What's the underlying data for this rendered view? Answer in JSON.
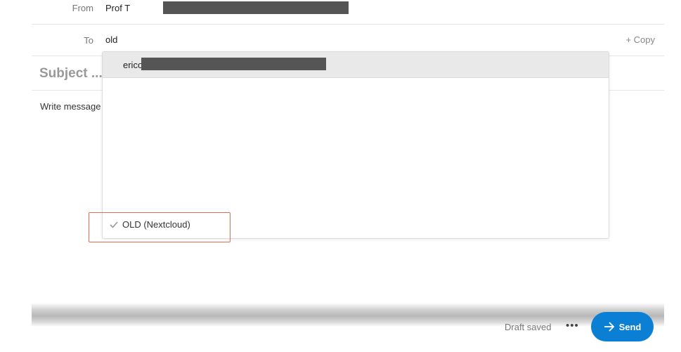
{
  "from": {
    "label": "From",
    "value": "Prof T"
  },
  "to": {
    "label": "To",
    "value": "old",
    "copy_label": "+ Copy"
  },
  "subject": {
    "placeholder": "Subject ..."
  },
  "message": {
    "placeholder": "Write message"
  },
  "dropdown": {
    "options": [
      {
        "text": "erico"
      }
    ],
    "footer_option": {
      "label": "OLD (Nextcloud)",
      "icon": "check-icon"
    }
  },
  "footer": {
    "draft_status": "Draft saved",
    "more_label": "•••",
    "send_label": "Send"
  },
  "colors": {
    "accent": "#0a7fd3",
    "highlight_box": "#e26d55"
  }
}
